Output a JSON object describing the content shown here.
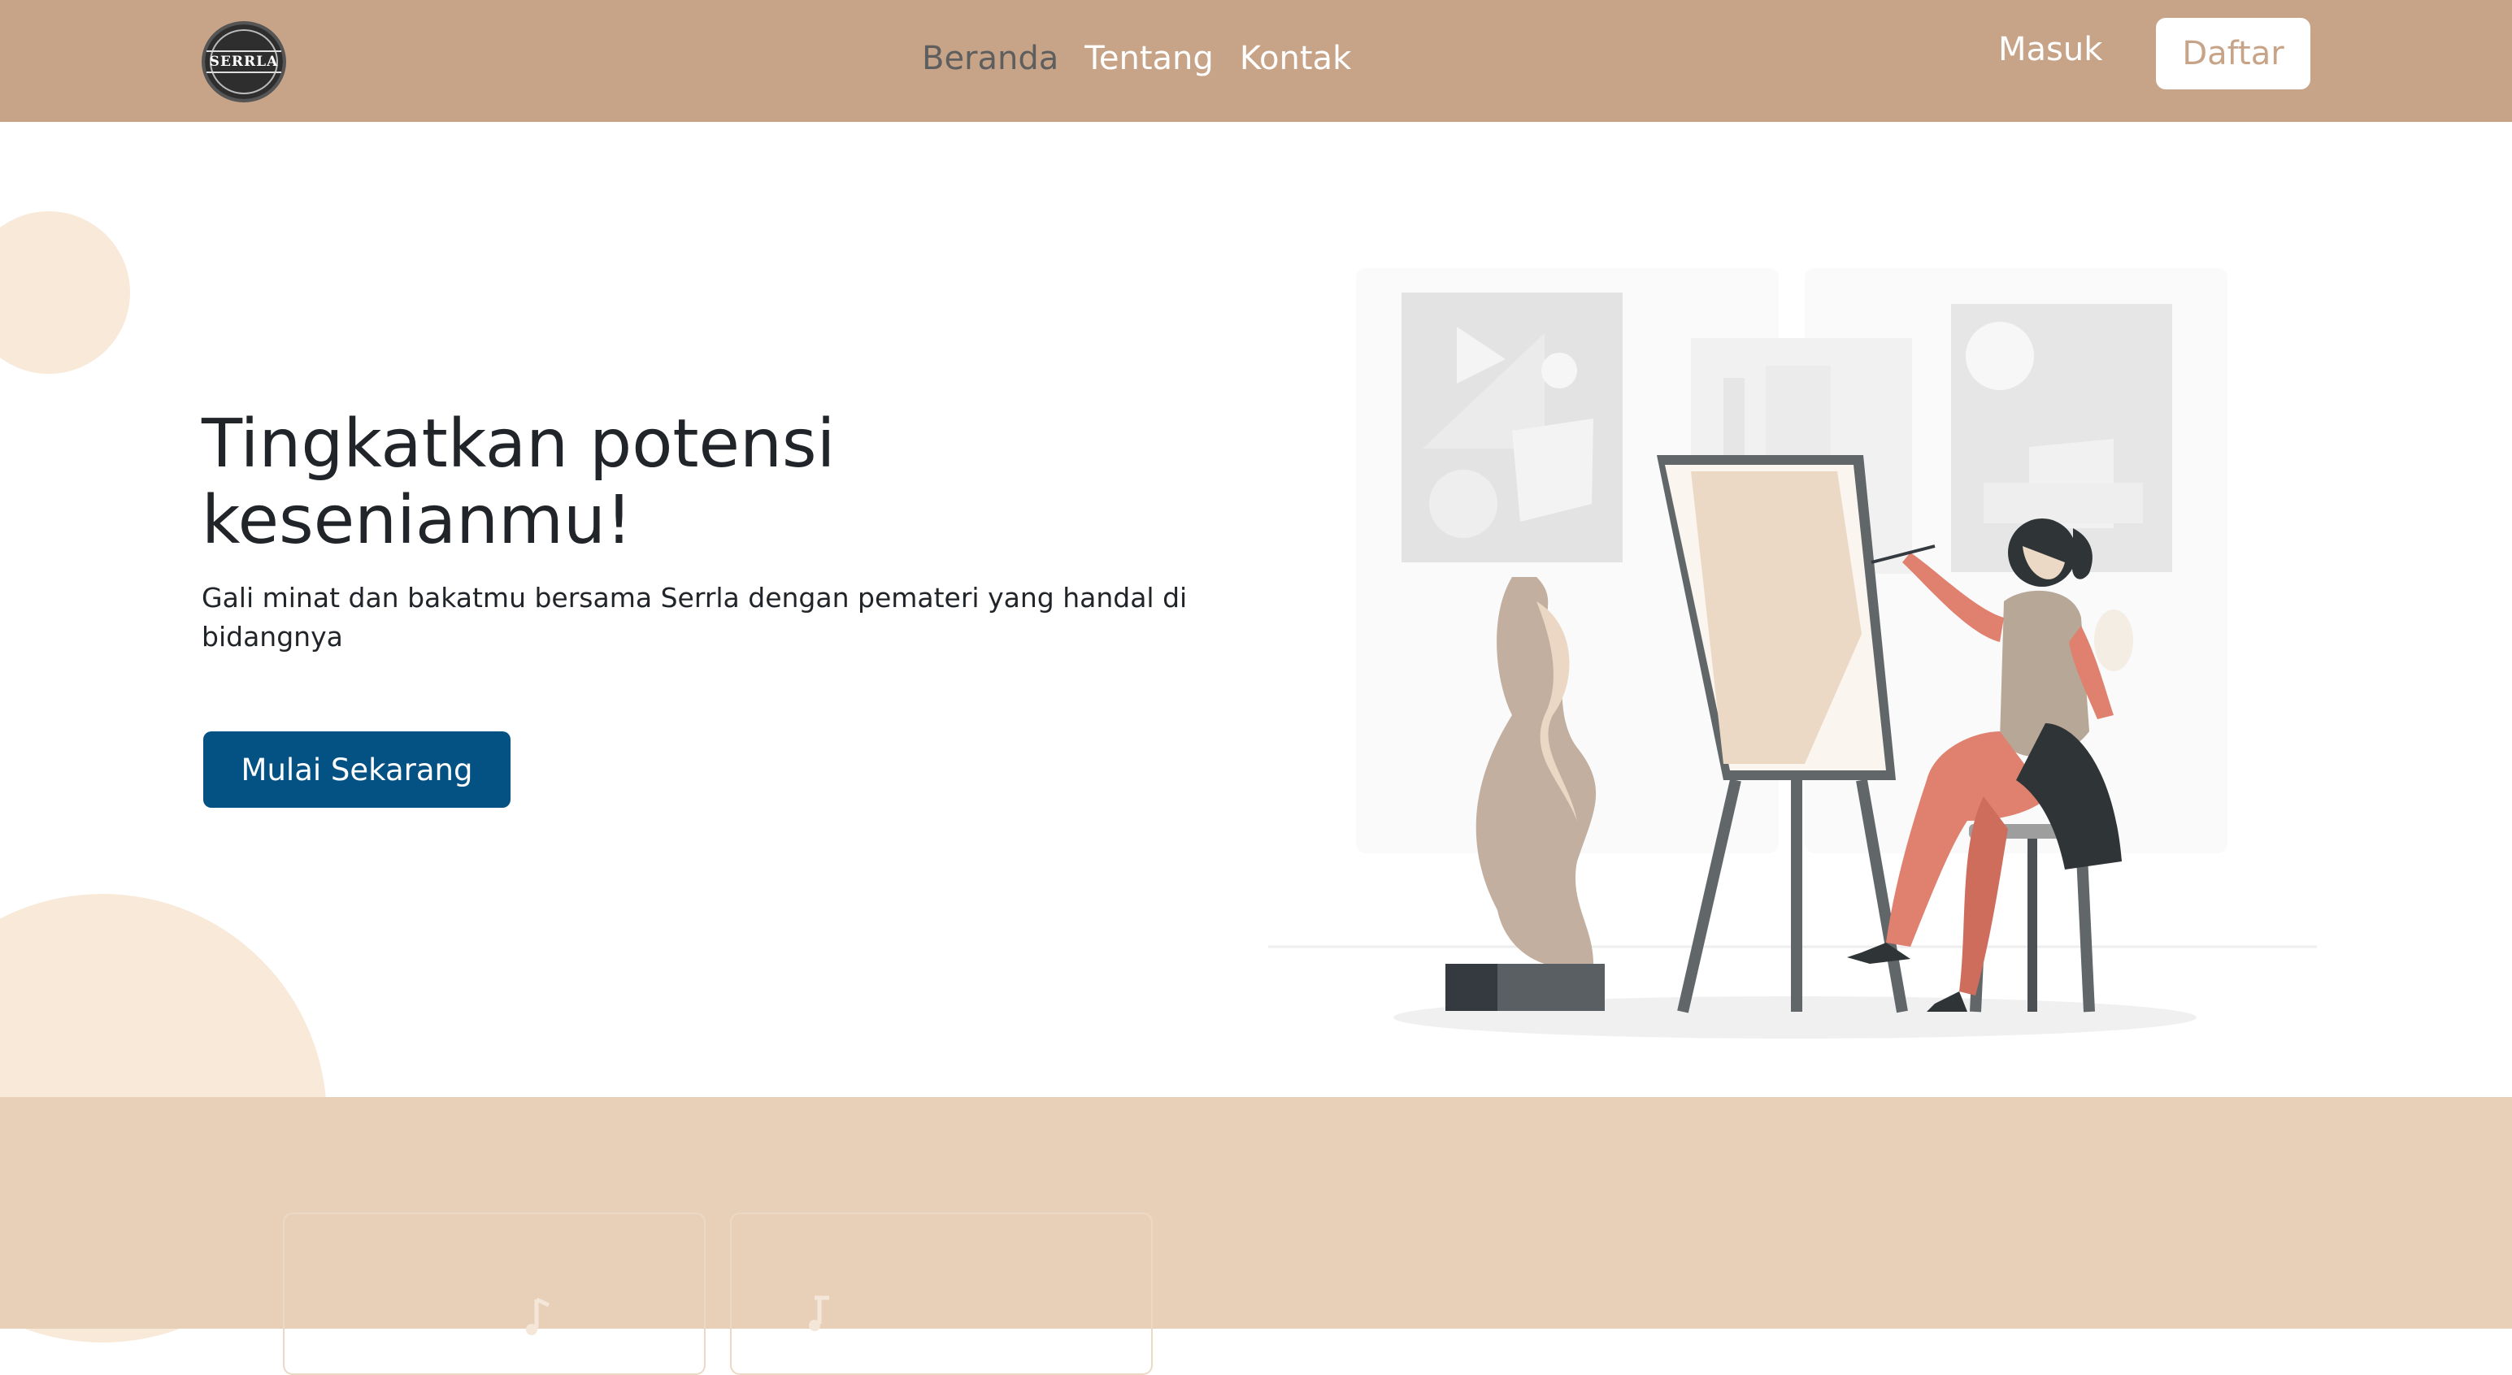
{
  "brand": {
    "logo_text": "SERRLA"
  },
  "nav": {
    "links": [
      {
        "label": "Beranda",
        "active": true
      },
      {
        "label": "Tentang",
        "active": false
      },
      {
        "label": "Kontak",
        "active": false
      }
    ],
    "login_label": "Masuk",
    "register_label": "Daftar"
  },
  "hero": {
    "title_line1": "Tingkatkan potensi",
    "title_line2": "kesenianmu!",
    "subtitle": "Gali minat dan bakatmu bersama Serrla dengan pemateri yang handal di bidangnya",
    "cta_label": "Mulai Sekarang",
    "illustration_icon": "painter-easel-illustration"
  },
  "colors": {
    "navbar": "#c7a488",
    "accent_button": "#045184",
    "section_bg": "#e8d0b8",
    "decor_circle": "#f8e9d9"
  },
  "features": {
    "cards": [
      {
        "icon": "music-note-icon"
      },
      {
        "icon": "music-note-icon"
      }
    ]
  }
}
